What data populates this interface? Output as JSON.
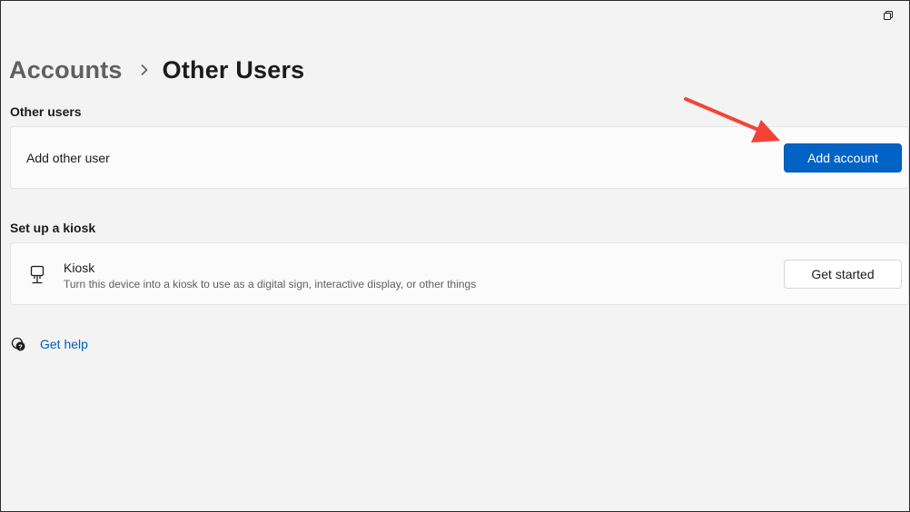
{
  "breadcrumb": {
    "parent": "Accounts",
    "current": "Other Users"
  },
  "sections": {
    "other_users": {
      "title": "Other users",
      "row_label": "Add other user",
      "button_label": "Add account"
    },
    "kiosk": {
      "title": "Set up a kiosk",
      "row_title": "Kiosk",
      "row_description": "Turn this device into a kiosk to use as a digital sign, interactive display, or other things",
      "button_label": "Get started"
    }
  },
  "help": {
    "label": "Get help"
  },
  "icons": {
    "breadcrumb_separator": "chevron-right-icon",
    "kiosk": "kiosk-icon",
    "help": "help-icon",
    "restore": "restore-icon",
    "annotation": "red-arrow"
  },
  "colors": {
    "accent": "#0063c5",
    "link": "#005fb8",
    "annotation_arrow": "#f44336"
  }
}
